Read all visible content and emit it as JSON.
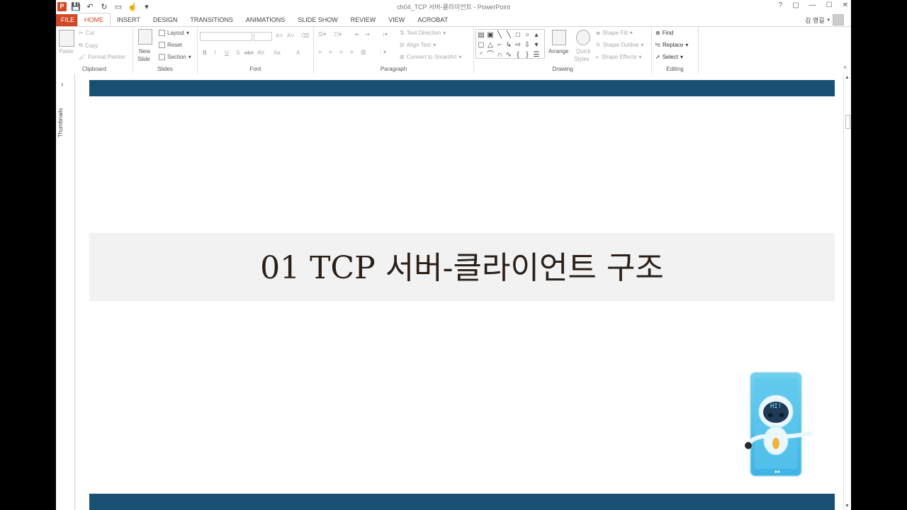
{
  "window": {
    "title": "ch04_TCP 서버-클라이언트 - PowerPoint",
    "controls": [
      "?",
      "▢",
      "—",
      "☐",
      "✕"
    ]
  },
  "tabs": [
    {
      "label": "FILE",
      "active": false
    },
    {
      "label": "HOME",
      "active": true
    },
    {
      "label": "INSERT",
      "active": false
    },
    {
      "label": "DESIGN",
      "active": false
    },
    {
      "label": "TRANSITIONS",
      "active": false
    },
    {
      "label": "ANIMATIONS",
      "active": false
    },
    {
      "label": "SLIDE SHOW",
      "active": false
    },
    {
      "label": "REVIEW",
      "active": false
    },
    {
      "label": "VIEW",
      "active": false
    },
    {
      "label": "ACROBAT",
      "active": false
    }
  ],
  "account": {
    "name": "김 영길"
  },
  "ribbon": {
    "clipboard": {
      "label": "Clipboard",
      "paste": "Paste",
      "cut": "Cut",
      "copy": "Copy",
      "format_painter": "Format Painter"
    },
    "slides": {
      "label": "Slides",
      "new_slide_1": "New",
      "new_slide_2": "Slide",
      "layout": "Layout",
      "reset": "Reset",
      "section": "Section"
    },
    "font": {
      "label": "Font",
      "bold": "B",
      "italic": "I",
      "underline": "U",
      "shadow": "S",
      "strike": "abc",
      "spacing": "AV",
      "case": "Aa",
      "color": "A"
    },
    "paragraph": {
      "label": "Paragraph",
      "text_direction": "Text Direction",
      "align_text": "Align Text",
      "convert_smartart": "Convert to SmartArt"
    },
    "drawing": {
      "label": "Drawing",
      "arrange": "Arrange",
      "quick_styles_1": "Quick",
      "quick_styles_2": "Styles",
      "shape_fill": "Shape Fill",
      "shape_outline": "Shape Outline",
      "shape_effects": "Shape Effects"
    },
    "editing": {
      "label": "Editing",
      "find": "Find",
      "replace": "Replace",
      "select": "Select"
    }
  },
  "thumbnails": {
    "label": "Thumbnails"
  },
  "slide": {
    "title": "01 TCP 서버-클라이언트 구조",
    "mascot_text": "HI!"
  },
  "colors": {
    "accent": "#d24726",
    "slide_bar": "#184f72",
    "band": "#f2f2f2"
  }
}
